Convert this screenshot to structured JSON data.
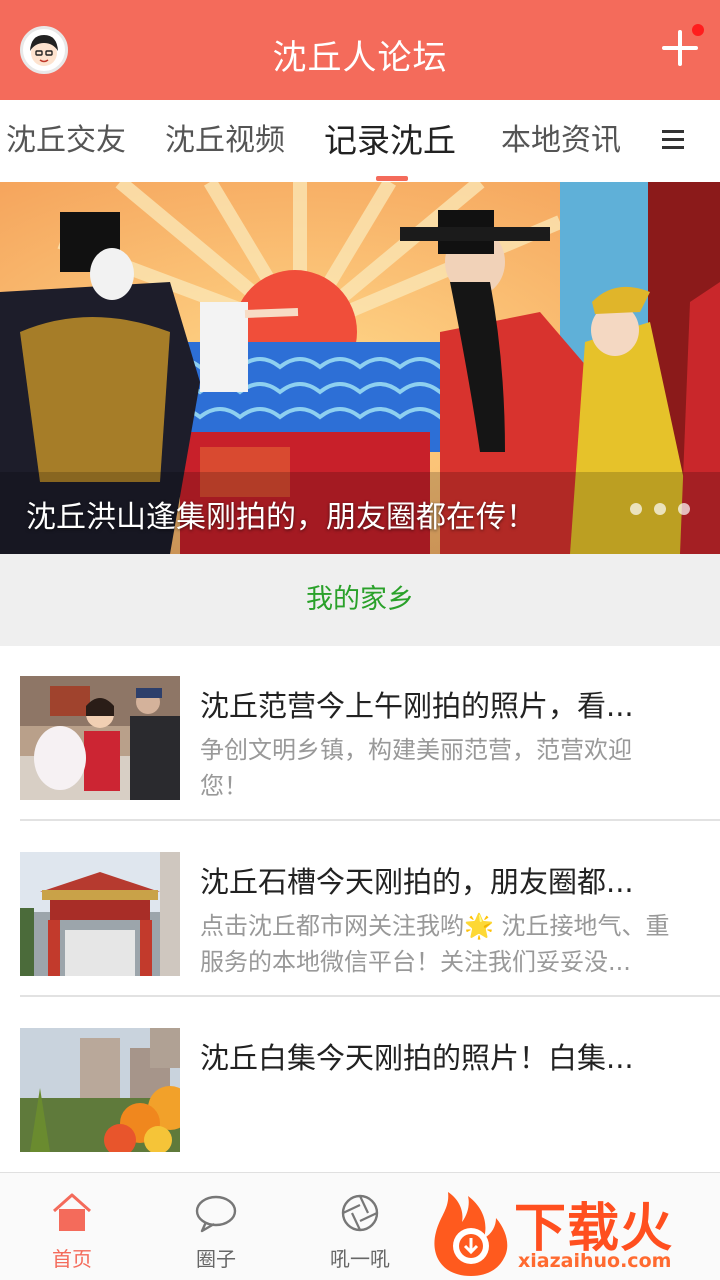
{
  "header": {
    "title": "沈丘人论坛",
    "avatar_icon": "cartoon-avatar-icon",
    "add_icon": "plus-icon",
    "accent_color": "#f46b5b"
  },
  "tabs": [
    {
      "label": "沈丘交友",
      "active": false
    },
    {
      "label": "沈丘视频",
      "active": false
    },
    {
      "label": "记录沈丘",
      "active": true
    },
    {
      "label": "本地资讯",
      "active": false
    }
  ],
  "tabs_menu_icon": "hamburger-icon",
  "banner": {
    "caption": "沈丘洪山逢集刚拍的，朋友圈都在传！",
    "slide_count": 3,
    "active_slide": 0
  },
  "section": {
    "title": "我的家乡"
  },
  "articles": [
    {
      "title": "沈丘范营今上午刚拍的照片，看...",
      "description": "争创文明乡镇，构建美丽范营，范营欢迎您！"
    },
    {
      "title": "沈丘石槽今天刚拍的，朋友圈都...",
      "description": "点击沈丘都市网关注我哟🌟 沈丘接地气、重服务的本地微信平台！关注我们妥妥没..."
    },
    {
      "title": "沈丘白集今天刚拍的照片！白集...",
      "description": ""
    }
  ],
  "bottom_nav": [
    {
      "label": "首页",
      "icon": "home-icon",
      "active": true
    },
    {
      "label": "圈子",
      "icon": "chat-bubble-icon",
      "active": false
    },
    {
      "label": "吼一吼",
      "icon": "aperture-icon",
      "active": false
    }
  ],
  "watermark": {
    "text": "下载火",
    "sub": "xiazaihuo.com"
  }
}
